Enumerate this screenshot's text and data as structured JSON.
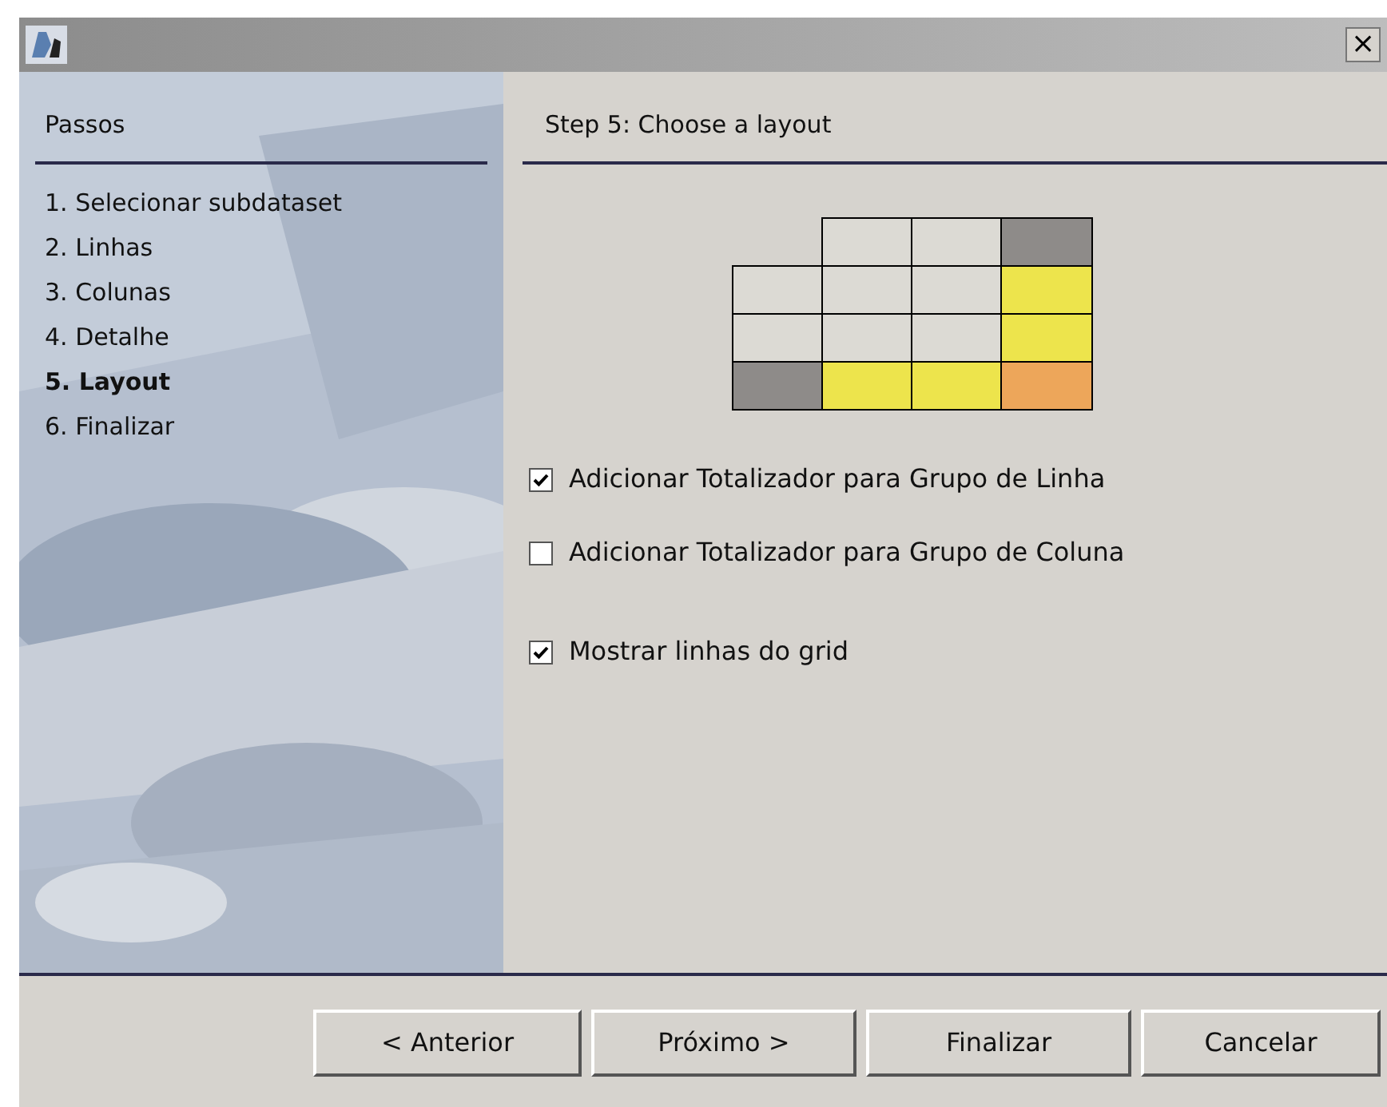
{
  "window": {
    "close": "×"
  },
  "sidebar": {
    "title": "Passos",
    "items": [
      {
        "label": "1. Selecionar subdataset",
        "selected": false
      },
      {
        "label": "2. Linhas",
        "selected": false
      },
      {
        "label": "3. Colunas",
        "selected": false
      },
      {
        "label": "4. Detalhe",
        "selected": false
      },
      {
        "label": "5. Layout",
        "selected": true
      },
      {
        "label": "6. Finalizar",
        "selected": false
      }
    ]
  },
  "content": {
    "title": "Step 5: Choose a layout",
    "layout_grid": [
      [
        {
          "kind": "empty"
        },
        {
          "kind": "cell",
          "color": "#dcdad4"
        },
        {
          "kind": "cell",
          "color": "#dcdad4"
        },
        {
          "kind": "cell",
          "color": "#8e8b89"
        }
      ],
      [
        {
          "kind": "cell",
          "color": "#dcdad4"
        },
        {
          "kind": "cell",
          "color": "#dcdad4"
        },
        {
          "kind": "cell",
          "color": "#dcdad4"
        },
        {
          "kind": "cell",
          "color": "#ede44c"
        }
      ],
      [
        {
          "kind": "cell",
          "color": "#dcdad4"
        },
        {
          "kind": "cell",
          "color": "#dcdad4"
        },
        {
          "kind": "cell",
          "color": "#dcdad4"
        },
        {
          "kind": "cell",
          "color": "#ede44c"
        }
      ],
      [
        {
          "kind": "cell",
          "color": "#8e8b89"
        },
        {
          "kind": "cell",
          "color": "#ede44c"
        },
        {
          "kind": "cell",
          "color": "#ede44c"
        },
        {
          "kind": "cell",
          "color": "#eda65a"
        }
      ]
    ],
    "options": [
      {
        "label": "Adicionar Totalizador para Grupo de Linha",
        "checked": true
      },
      {
        "label": "Adicionar Totalizador para Grupo de Coluna",
        "checked": false
      },
      {
        "label": "Mostrar linhas do grid",
        "checked": true
      }
    ]
  },
  "buttons": [
    "< Anterior",
    "Próximo >",
    "Finalizar",
    "Cancelar"
  ]
}
